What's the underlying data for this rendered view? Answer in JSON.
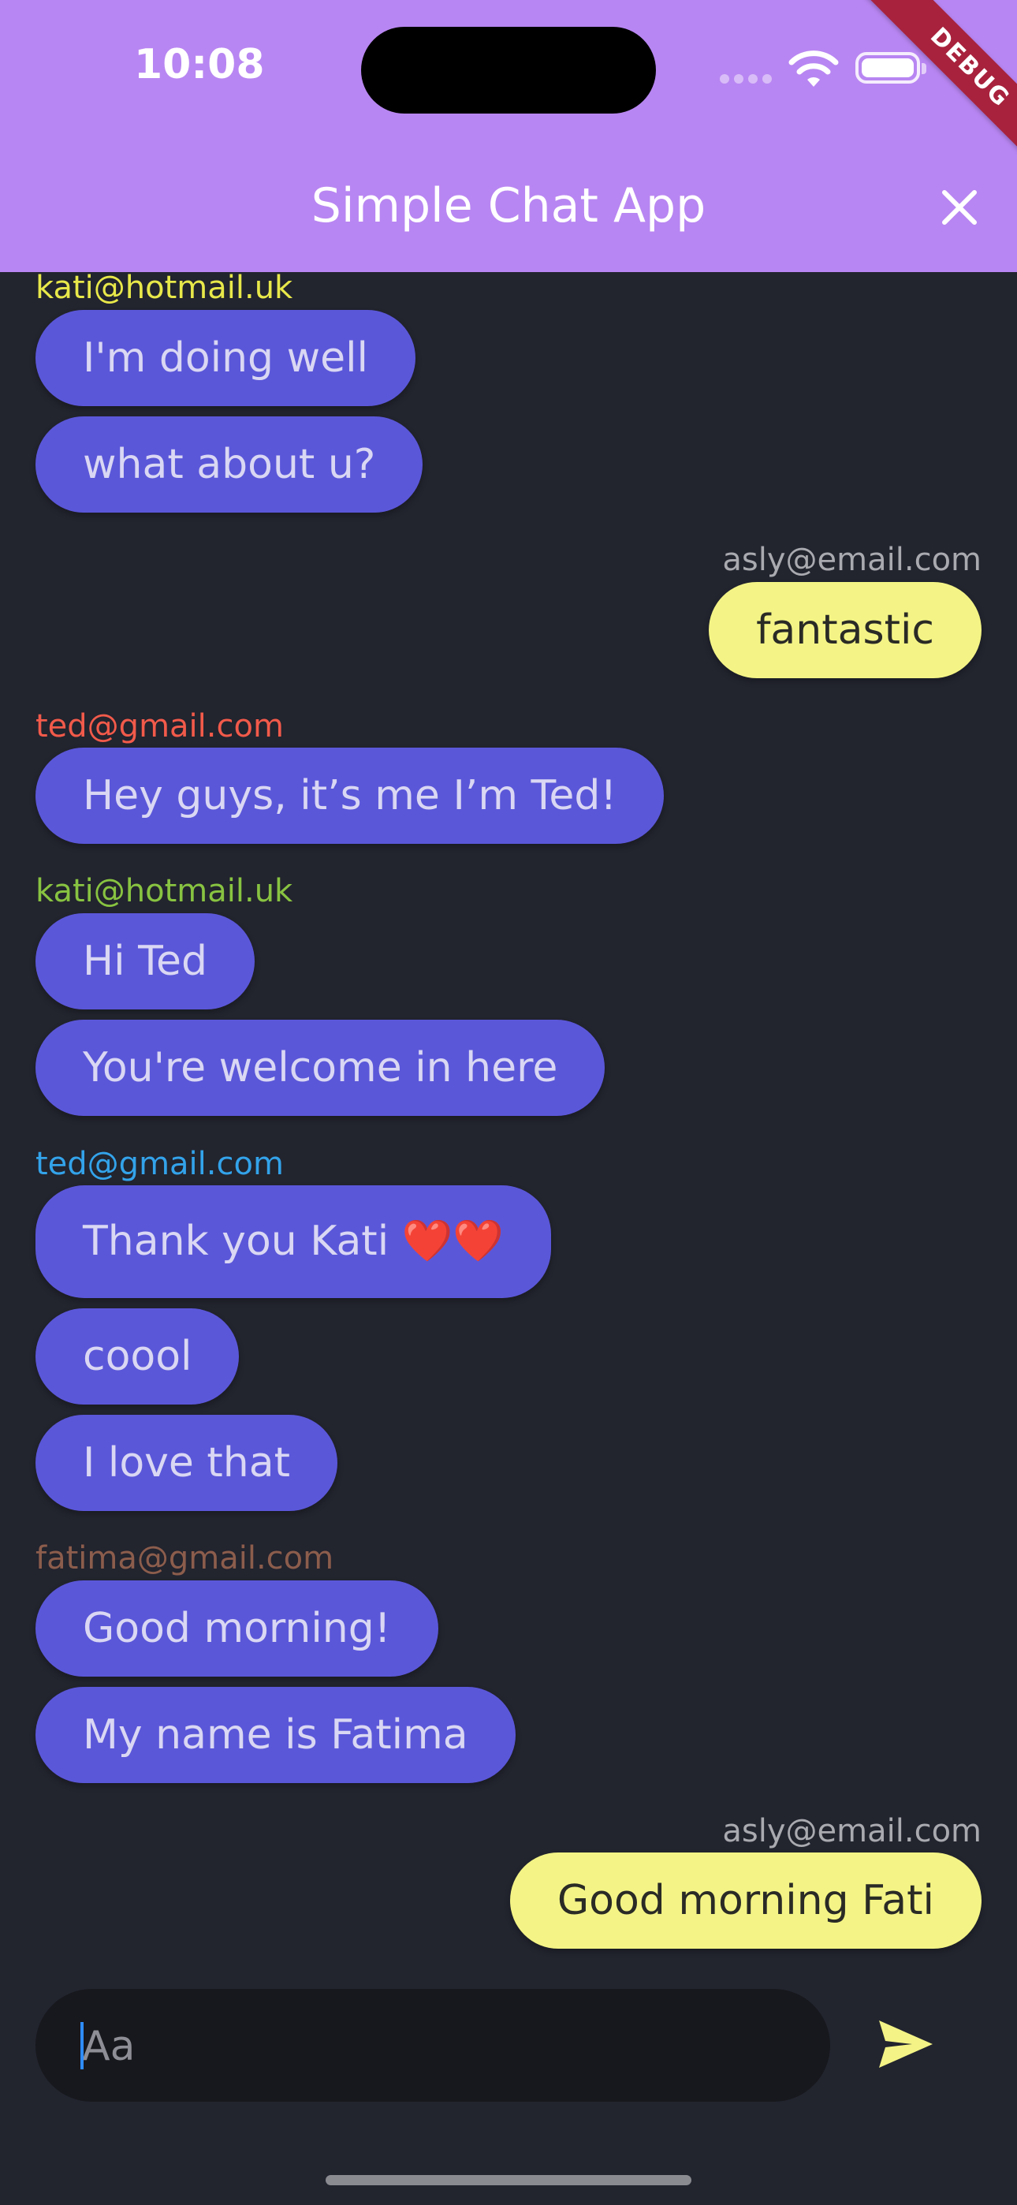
{
  "status_bar": {
    "time": "10:08"
  },
  "app_bar": {
    "title": "Simple Chat App"
  },
  "debug_banner": "DEBUG",
  "messages": [
    {
      "sender": "kati@hotmail.uk",
      "sender_color": "#e8e84a",
      "side": "in",
      "texts": [
        "I'm doing well",
        "what about u?"
      ]
    },
    {
      "sender": "asly@email.com",
      "sender_color": "#a9aab0",
      "side": "out",
      "texts": [
        "fantastic"
      ]
    },
    {
      "sender": "ted@gmail.com",
      "sender_color": "#f25a4a",
      "side": "in",
      "texts": [
        "Hey guys, it’s me I’m Ted!"
      ]
    },
    {
      "sender": "kati@hotmail.uk",
      "sender_color": "#88c341",
      "side": "in",
      "texts": [
        "Hi Ted",
        "You're welcome in here"
      ]
    },
    {
      "sender": "ted@gmail.com",
      "sender_color": "#33a3ea",
      "side": "in",
      "texts": [
        "Thank you Kati ❤️❤️",
        "coool",
        "I love that"
      ]
    },
    {
      "sender": "fatima@gmail.com",
      "sender_color": "#8c5d4c",
      "side": "in",
      "texts": [
        "Good morning!",
        "My name is Fatima"
      ]
    },
    {
      "sender": "asly@email.com",
      "sender_color": "#a9aab0",
      "side": "out",
      "texts": [
        "Good morning Fati"
      ]
    }
  ],
  "composer": {
    "placeholder": "Aa",
    "value": ""
  },
  "icons": {
    "close": "close-icon",
    "send": "send-icon",
    "wifi": "wifi-icon",
    "battery": "battery-icon"
  },
  "colors": {
    "app_bar": "#b886f2",
    "background": "#22242e",
    "incoming_bubble": "#5b57d9",
    "outgoing_bubble": "#f3f485"
  }
}
